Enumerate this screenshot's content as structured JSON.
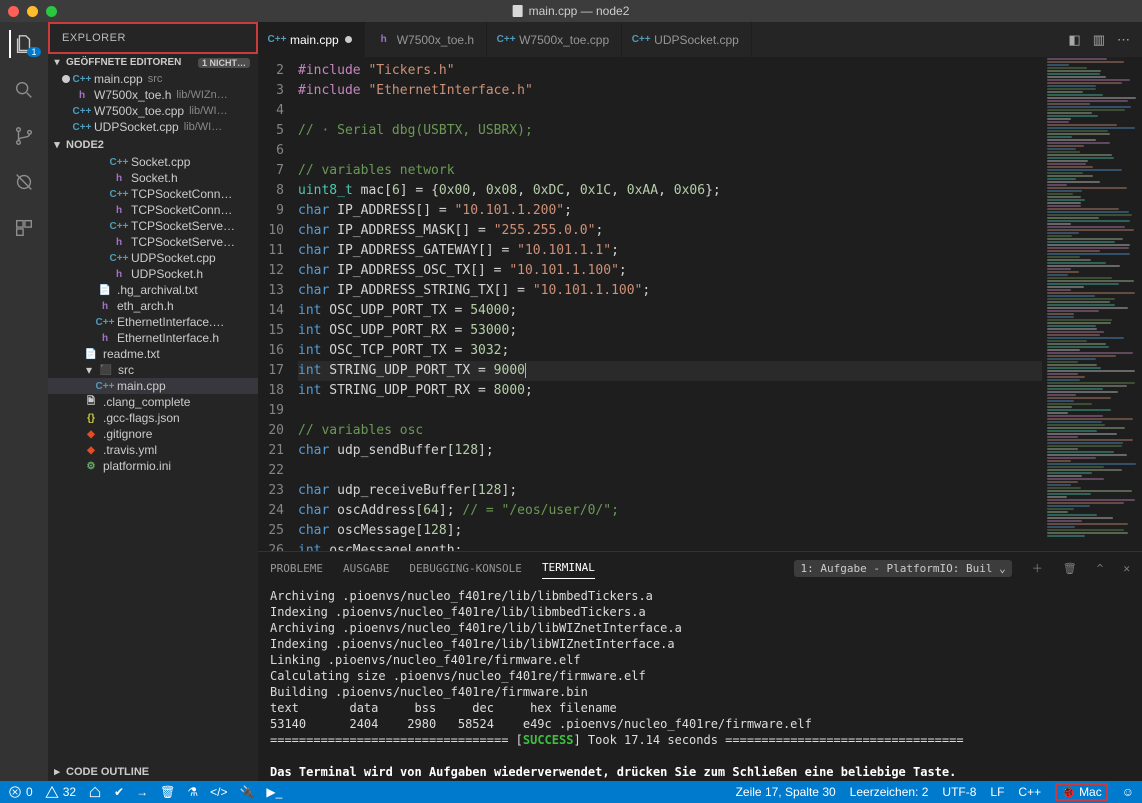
{
  "window": {
    "title": "main.cpp — node2"
  },
  "activity": {
    "badge": "1"
  },
  "sidebar": {
    "title": "EXPLORER",
    "openEditorsTitle": "GEÖFFNETE EDITOREN",
    "openEditorsBadge": "1 NICHT…",
    "projectTitle": "NODE2",
    "codeOutlineTitle": "CODE OUTLINE",
    "openEditors": [
      {
        "icon": "cpp",
        "iconText": "C++",
        "name": "main.cpp",
        "sub": "src",
        "modified": true
      },
      {
        "icon": "h",
        "iconText": "h",
        "name": "W7500x_toe.h",
        "sub": "lib/WIZn…"
      },
      {
        "icon": "cpp",
        "iconText": "C++",
        "name": "W7500x_toe.cpp",
        "sub": "lib/WI…"
      },
      {
        "icon": "cpp",
        "iconText": "C++",
        "name": "UDPSocket.cpp",
        "sub": "lib/WI…"
      }
    ],
    "tree": [
      {
        "indent": 1,
        "icon": "cpp",
        "iconText": "C++",
        "name": "Socket.cpp"
      },
      {
        "indent": 1,
        "icon": "h",
        "iconText": "h",
        "name": "Socket.h"
      },
      {
        "indent": 1,
        "icon": "cpp",
        "iconText": "C++",
        "name": "TCPSocketConn…"
      },
      {
        "indent": 1,
        "icon": "h",
        "iconText": "h",
        "name": "TCPSocketConn…"
      },
      {
        "indent": 1,
        "icon": "cpp",
        "iconText": "C++",
        "name": "TCPSocketServe…"
      },
      {
        "indent": 1,
        "icon": "h",
        "iconText": "h",
        "name": "TCPSocketServe…"
      },
      {
        "indent": 1,
        "icon": "cpp",
        "iconText": "C++",
        "name": "UDPSocket.cpp"
      },
      {
        "indent": 1,
        "icon": "h",
        "iconText": "h",
        "name": "UDPSocket.h"
      },
      {
        "indent": 0,
        "icon": "txt",
        "iconText": "📄",
        "name": ".hg_archival.txt"
      },
      {
        "indent": 0,
        "icon": "h",
        "iconText": "h",
        "name": "eth_arch.h"
      },
      {
        "indent": 0,
        "icon": "cpp",
        "iconText": "C++",
        "name": "EthernetInterface.…"
      },
      {
        "indent": 0,
        "icon": "h",
        "iconText": "h",
        "name": "EthernetInterface.h"
      },
      {
        "indent": -1,
        "icon": "txt",
        "iconText": "📄",
        "name": "readme.txt"
      },
      {
        "indent": -1,
        "icon": "fsrc",
        "iconText": "⬛",
        "name": "src",
        "folder": true,
        "open": true
      },
      {
        "indent": 0,
        "icon": "cpp",
        "iconText": "C++",
        "name": "main.cpp",
        "hl": true
      },
      {
        "indent": -1,
        "icon": "txt",
        "iconText": "🗎",
        "name": ".clang_complete"
      },
      {
        "indent": -1,
        "icon": "json",
        "iconText": "{}",
        "name": ".gcc-flags.json"
      },
      {
        "indent": -1,
        "icon": "git",
        "iconText": "◆",
        "name": ".gitignore"
      },
      {
        "indent": -1,
        "icon": "yml",
        "iconText": "◆",
        "name": ".travis.yml"
      },
      {
        "indent": -1,
        "icon": "ini",
        "iconText": "⚙",
        "name": "platformio.ini"
      }
    ]
  },
  "tabs": [
    {
      "icon": "cpp",
      "name": "main.cpp",
      "active": true,
      "modified": true
    },
    {
      "icon": "h",
      "name": "W7500x_toe.h"
    },
    {
      "icon": "cpp",
      "name": "W7500x_toe.cpp"
    },
    {
      "icon": "cpp",
      "name": "UDPSocket.cpp"
    }
  ],
  "editor": {
    "firstLine": 2,
    "lines": [
      "<span class='pp'>#include</span> <span class='str'>\"Tickers.h\"</span>",
      "<span class='pp'>#include</span> <span class='str'>\"EthernetInterface.h\"</span>",
      "",
      "<span class='cm'>// · Serial dbg(USBTX, USBRX);</span>",
      "",
      "<span class='cm'>// variables network</span>",
      "<span class='ty'>uint8_t</span> mac[<span class='num'>6</span>] = {<span class='num'>0x00</span>, <span class='num'>0x08</span>, <span class='num'>0xDC</span>, <span class='num'>0x1C</span>, <span class='num'>0xAA</span>, <span class='num'>0x06</span>};",
      "<span class='kw'>char</span> IP_ADDRESS[] = <span class='str'>\"10.101.1.200\"</span>;",
      "<span class='kw'>char</span> IP_ADDRESS_MASK[] = <span class='str'>\"255.255.0.0\"</span>;",
      "<span class='kw'>char</span> IP_ADDRESS_GATEWAY[] = <span class='str'>\"10.101.1.1\"</span>;",
      "<span class='kw'>char</span> IP_ADDRESS_OSC_TX[] = <span class='str'>\"10.101.1.100\"</span>;",
      "<span class='kw'>char</span> IP_ADDRESS_STRING_TX[] = <span class='str'>\"10.101.1.100\"</span>;",
      "<span class='kw'>int</span> OSC_UDP_PORT_TX = <span class='num'>54000</span>;",
      "<span class='kw'>int</span> OSC_UDP_PORT_RX = <span class='num'>53000</span>;",
      "<span class='kw'>int</span> OSC_TCP_PORT_TX = <span class='num'>3032</span>;",
      "<span class='kw'>int</span> STRING_UDP_PORT_TX = <span class='num'>9000</span><span class='caret'></span>",
      "<span class='kw'>int</span> STRING_UDP_PORT_RX = <span class='num'>8000</span>;",
      "",
      "<span class='cm'>// variables osc</span>",
      "<span class='kw'>char</span> udp_sendBuffer[<span class='num'>128</span>];",
      "",
      "<span class='kw'>char</span> udp_receiveBuffer[<span class='num'>128</span>];",
      "<span class='kw'>char</span> oscAddress[<span class='num'>64</span>]; <span class='cm'>// = \"/eos/user/0/\";</span>",
      "<span class='kw'>char</span> oscMessage[<span class='num'>128</span>];",
      "<span class='kw'>int</span> oscMessageLength;"
    ],
    "highlightLine": 17
  },
  "panel": {
    "tabs": {
      "problems": "PROBLEME",
      "output": "AUSGABE",
      "debug": "DEBUGGING-KONSOLE",
      "terminal": "TERMINAL"
    },
    "selector": "1: Aufgabe - PlatformIO: Buil ⌄",
    "output": [
      "Archiving .pioenvs/nucleo_f401re/lib/libmbedTickers.a",
      "Indexing .pioenvs/nucleo_f401re/lib/libmbedTickers.a",
      "Archiving .pioenvs/nucleo_f401re/lib/libWIZnetInterface.a",
      "Indexing .pioenvs/nucleo_f401re/lib/libWIZnetInterface.a",
      "Linking .pioenvs/nucleo_f401re/firmware.elf",
      "Calculating size .pioenvs/nucleo_f401re/firmware.elf",
      "Building .pioenvs/nucleo_f401re/firmware.bin",
      "text       data     bss     dec     hex filename",
      "53140      2404    2980   58524    e49c .pioenvs/nucleo_f401re/firmware.elf"
    ],
    "successLine": "================================= [<span class='succ'>SUCCESS</span>] Took 17.14 seconds =================================",
    "footer": "Das Terminal wird von Aufgaben wiederverwendet, drücken Sie zum Schließen eine beliebige Taste."
  },
  "status": {
    "errors": "0",
    "warnings": "32",
    "cursor": "Zeile 17, Spalte 30",
    "spaces": "Leerzeichen: 2",
    "encoding": "UTF-8",
    "eol": "LF",
    "lang": "C++",
    "mac": "Mac"
  }
}
